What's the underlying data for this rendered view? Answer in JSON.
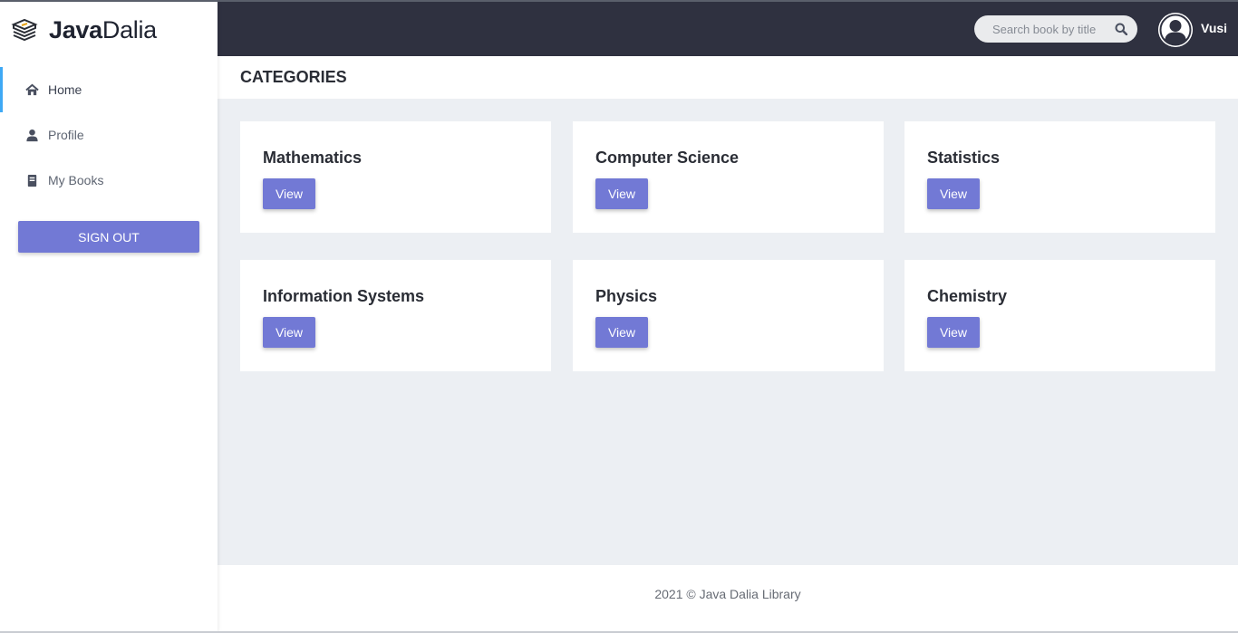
{
  "brand": {
    "name_bold": "Java",
    "name_light": "Dalia"
  },
  "sidebar": {
    "items": [
      {
        "label": "Home",
        "icon": "home-icon",
        "active": true
      },
      {
        "label": "Profile",
        "icon": "user-icon",
        "active": false
      },
      {
        "label": "My Books",
        "icon": "book-icon",
        "active": false
      }
    ],
    "signout_label": "SIGN OUT"
  },
  "topbar": {
    "search_placeholder": "Search book by title",
    "search_icon": "search-icon",
    "avatar_icon": "user-avatar-icon",
    "username": "Vusi"
  },
  "main": {
    "title": "CATEGORIES",
    "categories": [
      {
        "name": "Mathematics",
        "button": "View"
      },
      {
        "name": "Computer Science",
        "button": "View"
      },
      {
        "name": "Statistics",
        "button": "View"
      },
      {
        "name": "Information Systems",
        "button": "View"
      },
      {
        "name": "Physics",
        "button": "View"
      },
      {
        "name": "Chemistry",
        "button": "View"
      }
    ]
  },
  "footer": {
    "text": "2021 © Java Dalia Library"
  },
  "colors": {
    "accent": "#7279d5",
    "topbar": "#2f3140",
    "active_indicator": "#3fa9f5",
    "background": "#eceff3"
  }
}
